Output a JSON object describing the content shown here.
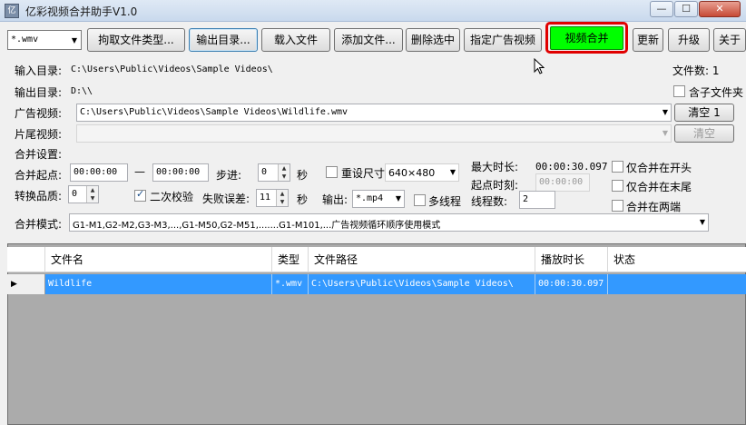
{
  "app": {
    "title": "亿彩视频合并助手V1.0",
    "icon_text": "亿"
  },
  "window": {
    "minimize": "—",
    "maximize": "☐",
    "close": "✕"
  },
  "toolbar": {
    "filetype_select": "*.wmv",
    "extract_types": "拘取文件类型...",
    "output_dir": "输出目录...",
    "load_files": "载入文件",
    "add_files": "添加文件...",
    "delete_selected": "删除选中",
    "set_ad_video": "指定广告视频",
    "merge_video": "视频合并",
    "update": "更新",
    "upgrade": "升级",
    "about": "关于"
  },
  "info": {
    "input_dir_label": "输入目录:",
    "input_dir_value": "C:\\Users\\Public\\Videos\\Sample Videos\\",
    "output_dir_label": "输出目录:",
    "output_dir_value": "D:\\\\",
    "file_count": "文件数: 1",
    "include_subfolders": "含子文件夹"
  },
  "ad": {
    "ad_label": "广告视频:",
    "ad_value": "C:\\Users\\Public\\Videos\\Sample Videos\\Wildlife.wmv",
    "clear1": "清空 1",
    "tail_label": "片尾视频:",
    "tail_value": "",
    "clear2": "清空"
  },
  "settings": {
    "section": "合并设置:",
    "start_label": "合并起点:",
    "start_value": "00:00:00",
    "dash": "—",
    "end_value": "00:00:00",
    "step_label": "步进:",
    "step_value": "0",
    "sec1": "秒",
    "resize_label": "重设尺寸",
    "resize_value": "640×480",
    "max_duration_label": "最大时长:",
    "max_duration_value": "00:00:30.097",
    "start_time_label": "起点时刻:",
    "start_time_value": "00:00:00",
    "only_start": "仅合并在开头",
    "only_end": "仅合并在末尾",
    "both_ends": "合并在两端",
    "quality_label": "转换品质:",
    "quality_value": "0",
    "second_check": "二次校验",
    "fail_error_label": "失败误差:",
    "fail_error_value": "11",
    "sec2": "秒",
    "output_label": "输出:",
    "output_value": "*.mp4",
    "multithread": "多线程",
    "threads_label": "线程数:",
    "threads_value": "2",
    "mode_label": "合并模式:",
    "mode_value": "G1-M1,G2-M2,G3-M3,...,G1-M50,G2-M51,.......G1-M101,...广告视频循环顺序使用模式"
  },
  "table": {
    "headers": [
      "文件名",
      "类型",
      "文件路径",
      "播放时长",
      "状态"
    ],
    "rows": [
      {
        "name": "Wildlife",
        "type": "*.wmv",
        "path": "C:\\Users\\Public\\Videos\\Sample Videos\\",
        "duration": "00:00:30.097",
        "status": ""
      }
    ],
    "row_marker": "▶"
  },
  "colors": {
    "merge_button": "#00ff00",
    "highlight": "#e00000",
    "selection": "#3399ff",
    "grid_bg": "#ababab"
  }
}
